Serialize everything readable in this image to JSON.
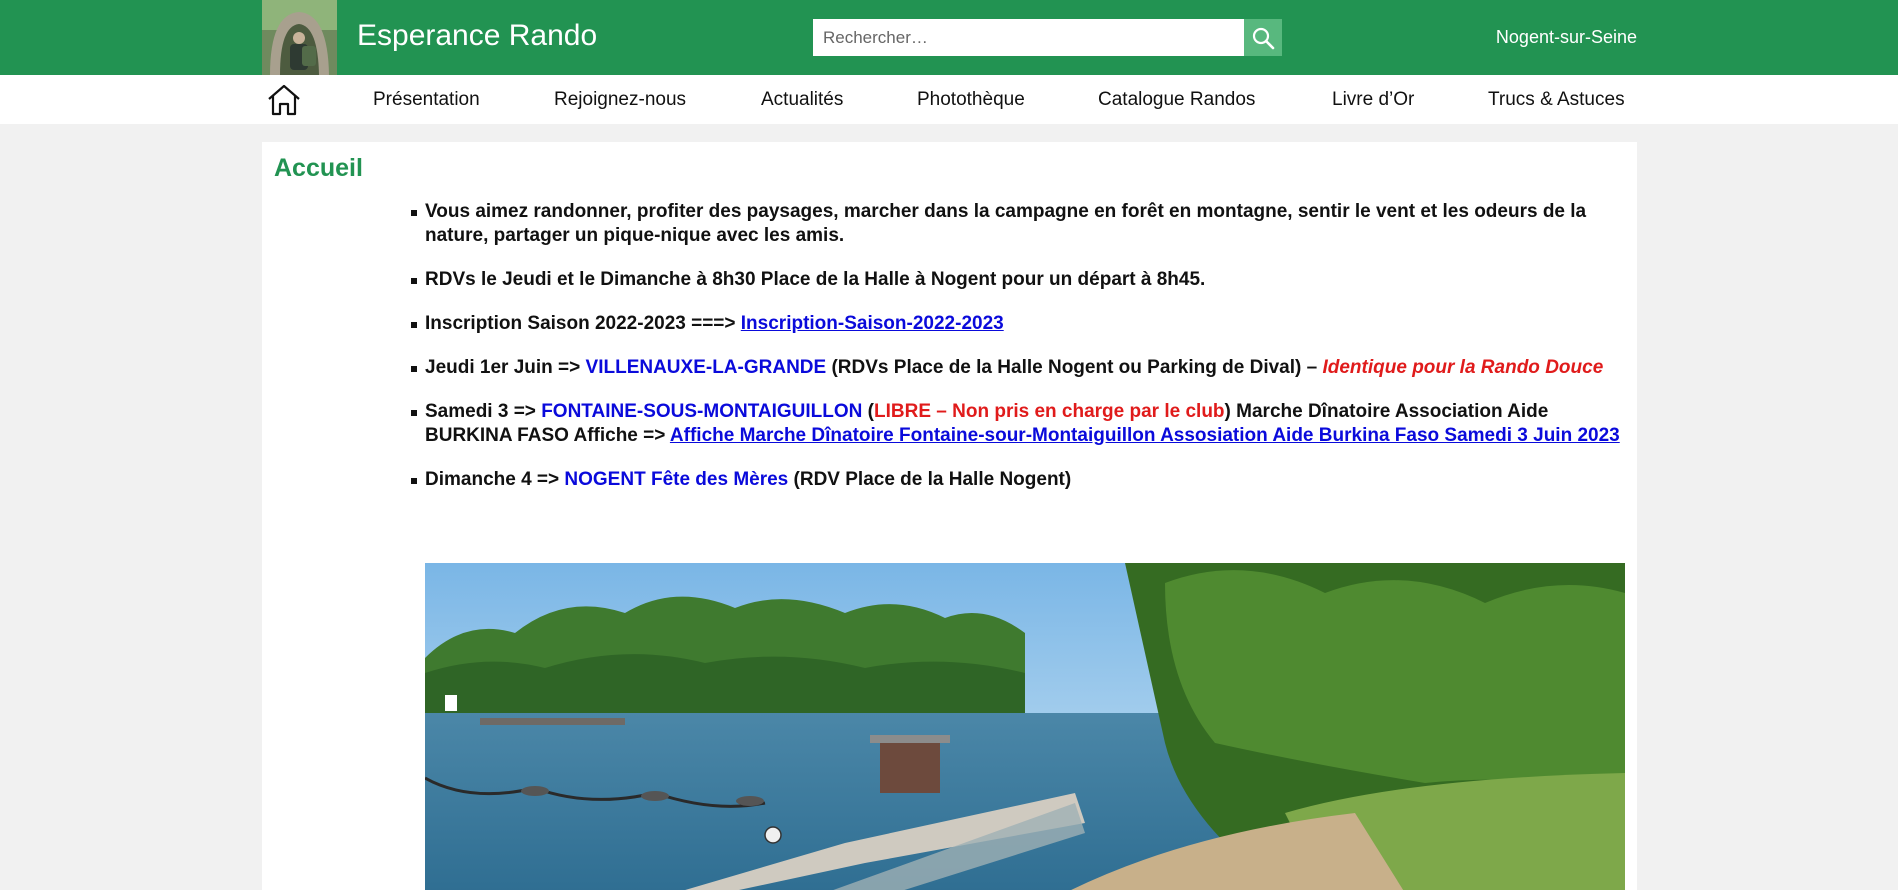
{
  "site": {
    "title": "Esperance Rando",
    "town": "Nogent-sur-Seine"
  },
  "search": {
    "placeholder": "Rechercher…"
  },
  "nav": {
    "items": [
      {
        "label": "Présentation"
      },
      {
        "label": "Rejoignez-nous"
      },
      {
        "label": "Actualités"
      },
      {
        "label": "Photothèque"
      },
      {
        "label": "Catalogue Randos"
      },
      {
        "label": "Livre d’Or"
      },
      {
        "label": "Trucs & Astuces"
      }
    ]
  },
  "main": {
    "title": "Accueil",
    "bullets": {
      "b1": {
        "text": "Vous aimez randonner, profiter des paysages, marcher dans la campagne en forêt en montagne, sentir le vent et les odeurs de la nature, partager un pique-nique avec les amis."
      },
      "b2": {
        "text": "RDVs le Jeudi et le Dimanche à 8h30 Place de la Halle à Nogent pour un départ à 8h45."
      },
      "b3": {
        "prefix": "Inscription Saison 2022-2023 ===> ",
        "link": "Inscription-Saison-2022-2023"
      },
      "b4": {
        "prefix": "Jeudi 1er Juin => ",
        "place": "VILLENAUXE-LA-GRANDE",
        "middle": " (RDVs Place de la Halle Nogent ou Parking de Dival) – ",
        "note": "Identique pour la Rando Douce"
      },
      "b5": {
        "prefix": "Samedi 3 => ",
        "place": "FONTAINE-SOUS-MONTAIGUILLON",
        "open": " (",
        "red": "LIBRE – Non pris en charge par le club",
        "middle": ") Marche Dînatoire Association Aide BURKINA FASO Affiche => ",
        "link": "Affiche Marche Dînatoire Fontaine-sour-Montaiguillon Assosiation Aide Burkina Faso Samedi 3 Juin 2023"
      },
      "b6": {
        "prefix": "Dimanche 4 => ",
        "place": "NOGENT Fête des Mères",
        "suffix": " (RDV Place de la Halle Nogent)"
      }
    }
  },
  "colors": {
    "brand": "#229352",
    "link": "#0a0adb",
    "alert": "#e01b1b",
    "background": "#f1f1f1"
  },
  "icons": {
    "search": "search-icon",
    "home": "home-icon"
  }
}
